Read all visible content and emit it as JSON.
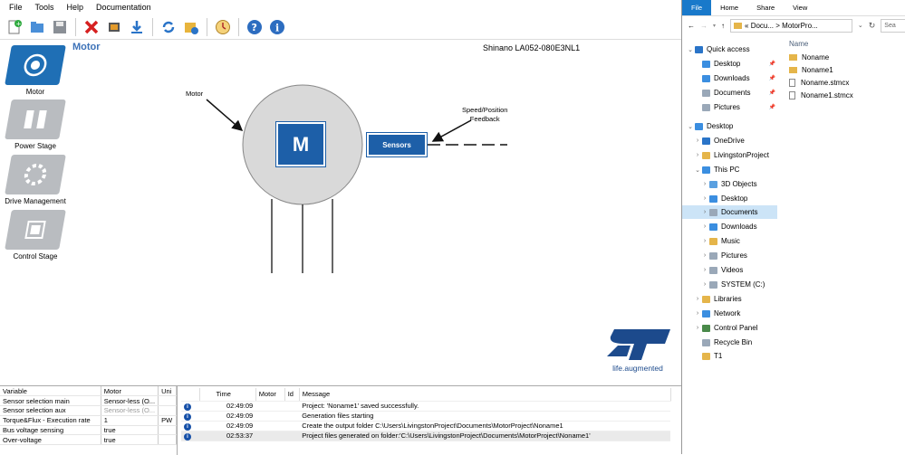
{
  "menu": [
    "File",
    "Tools",
    "Help",
    "Documentation"
  ],
  "toolbar": [
    "new-project-icon",
    "open-icon",
    "save-icon",
    "delete-icon",
    "build-icon",
    "download-icon",
    "refresh-icon",
    "folder-gear-icon",
    "clock-icon",
    "help-icon",
    "info-icon"
  ],
  "sidebar": [
    {
      "label": "Motor",
      "icon": "motor-icon",
      "active": true
    },
    {
      "label": "Power Stage",
      "icon": "power-stage-icon",
      "active": false
    },
    {
      "label": "Drive Management",
      "icon": "drive-management-icon",
      "active": false
    },
    {
      "label": "Control Stage",
      "icon": "control-stage-icon",
      "active": false
    }
  ],
  "page_title": "Motor",
  "motor_model": "Shinano LA052-080E3NL1",
  "diagram": {
    "motor_label": "Motor",
    "motor_block": "M",
    "sensors_block": "Sensors",
    "feedback_label_1": "Speed/Position",
    "feedback_label_2": "Feedback"
  },
  "logo_tagline": "life.augmented",
  "variables": {
    "headers": [
      "Variable",
      "Motor",
      "Uni"
    ],
    "rows": [
      [
        "Sensor selection main",
        "Sensor-less (O...",
        ""
      ],
      [
        "Sensor selection aux",
        "Sensor-less (O...",
        ""
      ],
      [
        "Torque&Flux - Execution rate",
        "1",
        "PW"
      ],
      [
        "Bus voltage sensing",
        "true",
        ""
      ],
      [
        "Over-voltage",
        "true",
        ""
      ]
    ]
  },
  "log": {
    "headers": [
      "",
      "Time",
      "Motor",
      "Id",
      "Message"
    ],
    "rows": [
      [
        "02:49:09",
        "",
        "",
        "Project: 'Noname1' saved successfully."
      ],
      [
        "02:49:09",
        "",
        "",
        "Generation files starting"
      ],
      [
        "02:49:09",
        "",
        "",
        "Create the output folder C:\\Users\\LivingstonProject\\Documents\\MotorProject\\Noname1"
      ],
      [
        "02:53:37",
        "",
        "",
        "Project files generated on folder:'C:\\Users\\LivingstonProject\\Documents\\MotorProject\\Noname1'"
      ]
    ]
  },
  "explorer": {
    "tabs": [
      "File",
      "Home",
      "Share",
      "View"
    ],
    "address": "« Docu... > MotorPro...",
    "search_placeholder": "Sea",
    "column_header": "Name",
    "tree": [
      {
        "label": "Quick access",
        "indent": 0,
        "chev": "v",
        "icon": "star-icon",
        "color": "#2a74c8",
        "pin": false
      },
      {
        "label": "Desktop",
        "indent": 1,
        "chev": "",
        "icon": "desktop-icon",
        "color": "#3b8ee0",
        "pin": true
      },
      {
        "label": "Downloads",
        "indent": 1,
        "chev": "",
        "icon": "downloads-icon",
        "color": "#3b8ee0",
        "pin": true
      },
      {
        "label": "Documents",
        "indent": 1,
        "chev": "",
        "icon": "documents-icon",
        "color": "#9aa8b8",
        "pin": true
      },
      {
        "label": "Pictures",
        "indent": 1,
        "chev": "",
        "icon": "pictures-icon",
        "color": "#9aa8b8",
        "pin": true
      },
      {
        "label": "Desktop",
        "indent": 0,
        "chev": "v",
        "icon": "desktop-icon",
        "color": "#3b8ee0",
        "pin": false
      },
      {
        "label": "OneDrive",
        "indent": 1,
        "chev": ">",
        "icon": "onedrive-icon",
        "color": "#2a74c8",
        "pin": false
      },
      {
        "label": "LivingstonProject",
        "indent": 1,
        "chev": ">",
        "icon": "user-icon",
        "color": "#e5b54a",
        "pin": false
      },
      {
        "label": "This PC",
        "indent": 1,
        "chev": "v",
        "icon": "pc-icon",
        "color": "#3b8ee0",
        "pin": false
      },
      {
        "label": "3D Objects",
        "indent": 2,
        "chev": ">",
        "icon": "3d-objects-icon",
        "color": "#5aa0e0",
        "pin": false
      },
      {
        "label": "Desktop",
        "indent": 2,
        "chev": ">",
        "icon": "desktop-icon",
        "color": "#3b8ee0",
        "pin": false
      },
      {
        "label": "Documents",
        "indent": 2,
        "chev": ">",
        "icon": "documents-icon",
        "color": "#9aa8b8",
        "pin": false
      },
      {
        "label": "Downloads",
        "indent": 2,
        "chev": ">",
        "icon": "downloads-icon",
        "color": "#3b8ee0",
        "pin": false
      },
      {
        "label": "Music",
        "indent": 2,
        "chev": ">",
        "icon": "music-icon",
        "color": "#e5b54a",
        "pin": false
      },
      {
        "label": "Pictures",
        "indent": 2,
        "chev": ">",
        "icon": "pictures-icon",
        "color": "#9aa8b8",
        "pin": false
      },
      {
        "label": "Videos",
        "indent": 2,
        "chev": ">",
        "icon": "videos-icon",
        "color": "#9aa8b8",
        "pin": false
      },
      {
        "label": "SYSTEM (C:)",
        "indent": 2,
        "chev": ">",
        "icon": "drive-icon",
        "color": "#9aa8b8",
        "pin": false
      },
      {
        "label": "Libraries",
        "indent": 1,
        "chev": ">",
        "icon": "libraries-icon",
        "color": "#e5b54a",
        "pin": false
      },
      {
        "label": "Network",
        "indent": 1,
        "chev": ">",
        "icon": "network-icon",
        "color": "#3b8ee0",
        "pin": false
      },
      {
        "label": "Control Panel",
        "indent": 1,
        "chev": ">",
        "icon": "control-panel-icon",
        "color": "#4a8a4a",
        "pin": false
      },
      {
        "label": "Recycle Bin",
        "indent": 1,
        "chev": "",
        "icon": "recycle-bin-icon",
        "color": "#9aa8b8",
        "pin": false
      },
      {
        "label": "T1",
        "indent": 1,
        "chev": "",
        "icon": "folder-icon",
        "color": "#e5b54a",
        "pin": false
      }
    ],
    "selected_tree_item": "Documents",
    "files": [
      {
        "name": "Noname",
        "icon": "folder-icon"
      },
      {
        "name": "Noname1",
        "icon": "folder-icon"
      },
      {
        "name": "Noname.stmcx",
        "icon": "file-icon"
      },
      {
        "name": "Noname1.stmcx",
        "icon": "file-icon"
      }
    ]
  },
  "colors": {
    "accent": "#1f6fb5",
    "block": "#1d5fa8",
    "explorer_file_tab": "#1979ca",
    "selection": "#cce4f7"
  }
}
